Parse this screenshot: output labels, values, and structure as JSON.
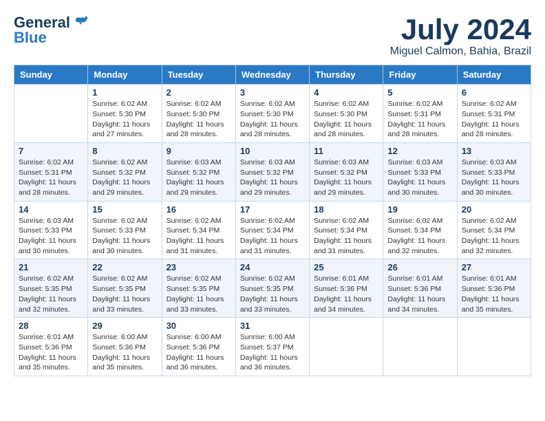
{
  "logo": {
    "line1": "General",
    "line2": "Blue"
  },
  "title": "July 2024",
  "location": "Miguel Calmon, Bahia, Brazil",
  "days_of_week": [
    "Sunday",
    "Monday",
    "Tuesday",
    "Wednesday",
    "Thursday",
    "Friday",
    "Saturday"
  ],
  "weeks": [
    [
      {
        "day": "",
        "info": ""
      },
      {
        "day": "1",
        "info": "Sunrise: 6:02 AM\nSunset: 5:30 PM\nDaylight: 11 hours\nand 27 minutes."
      },
      {
        "day": "2",
        "info": "Sunrise: 6:02 AM\nSunset: 5:30 PM\nDaylight: 11 hours\nand 28 minutes."
      },
      {
        "day": "3",
        "info": "Sunrise: 6:02 AM\nSunset: 5:30 PM\nDaylight: 11 hours\nand 28 minutes."
      },
      {
        "day": "4",
        "info": "Sunrise: 6:02 AM\nSunset: 5:30 PM\nDaylight: 11 hours\nand 28 minutes."
      },
      {
        "day": "5",
        "info": "Sunrise: 6:02 AM\nSunset: 5:31 PM\nDaylight: 11 hours\nand 28 minutes."
      },
      {
        "day": "6",
        "info": "Sunrise: 6:02 AM\nSunset: 5:31 PM\nDaylight: 11 hours\nand 28 minutes."
      }
    ],
    [
      {
        "day": "7",
        "info": "Sunrise: 6:02 AM\nSunset: 5:31 PM\nDaylight: 11 hours\nand 28 minutes."
      },
      {
        "day": "8",
        "info": "Sunrise: 6:02 AM\nSunset: 5:32 PM\nDaylight: 11 hours\nand 29 minutes."
      },
      {
        "day": "9",
        "info": "Sunrise: 6:03 AM\nSunset: 5:32 PM\nDaylight: 11 hours\nand 29 minutes."
      },
      {
        "day": "10",
        "info": "Sunrise: 6:03 AM\nSunset: 5:32 PM\nDaylight: 11 hours\nand 29 minutes."
      },
      {
        "day": "11",
        "info": "Sunrise: 6:03 AM\nSunset: 5:32 PM\nDaylight: 11 hours\nand 29 minutes."
      },
      {
        "day": "12",
        "info": "Sunrise: 6:03 AM\nSunset: 5:33 PM\nDaylight: 11 hours\nand 30 minutes."
      },
      {
        "day": "13",
        "info": "Sunrise: 6:03 AM\nSunset: 5:33 PM\nDaylight: 11 hours\nand 30 minutes."
      }
    ],
    [
      {
        "day": "14",
        "info": "Sunrise: 6:03 AM\nSunset: 5:33 PM\nDaylight: 11 hours\nand 30 minutes."
      },
      {
        "day": "15",
        "info": "Sunrise: 6:02 AM\nSunset: 5:33 PM\nDaylight: 11 hours\nand 30 minutes."
      },
      {
        "day": "16",
        "info": "Sunrise: 6:02 AM\nSunset: 5:34 PM\nDaylight: 11 hours\nand 31 minutes."
      },
      {
        "day": "17",
        "info": "Sunrise: 6:02 AM\nSunset: 5:34 PM\nDaylight: 11 hours\nand 31 minutes."
      },
      {
        "day": "18",
        "info": "Sunrise: 6:02 AM\nSunset: 5:34 PM\nDaylight: 11 hours\nand 31 minutes."
      },
      {
        "day": "19",
        "info": "Sunrise: 6:02 AM\nSunset: 5:34 PM\nDaylight: 11 hours\nand 32 minutes."
      },
      {
        "day": "20",
        "info": "Sunrise: 6:02 AM\nSunset: 5:34 PM\nDaylight: 11 hours\nand 32 minutes."
      }
    ],
    [
      {
        "day": "21",
        "info": "Sunrise: 6:02 AM\nSunset: 5:35 PM\nDaylight: 11 hours\nand 32 minutes."
      },
      {
        "day": "22",
        "info": "Sunrise: 6:02 AM\nSunset: 5:35 PM\nDaylight: 11 hours\nand 33 minutes."
      },
      {
        "day": "23",
        "info": "Sunrise: 6:02 AM\nSunset: 5:35 PM\nDaylight: 11 hours\nand 33 minutes."
      },
      {
        "day": "24",
        "info": "Sunrise: 6:02 AM\nSunset: 5:35 PM\nDaylight: 11 hours\nand 33 minutes."
      },
      {
        "day": "25",
        "info": "Sunrise: 6:01 AM\nSunset: 5:36 PM\nDaylight: 11 hours\nand 34 minutes."
      },
      {
        "day": "26",
        "info": "Sunrise: 6:01 AM\nSunset: 5:36 PM\nDaylight: 11 hours\nand 34 minutes."
      },
      {
        "day": "27",
        "info": "Sunrise: 6:01 AM\nSunset: 5:36 PM\nDaylight: 11 hours\nand 35 minutes."
      }
    ],
    [
      {
        "day": "28",
        "info": "Sunrise: 6:01 AM\nSunset: 5:36 PM\nDaylight: 11 hours\nand 35 minutes."
      },
      {
        "day": "29",
        "info": "Sunrise: 6:00 AM\nSunset: 5:36 PM\nDaylight: 11 hours\nand 35 minutes."
      },
      {
        "day": "30",
        "info": "Sunrise: 6:00 AM\nSunset: 5:36 PM\nDaylight: 11 hours\nand 36 minutes."
      },
      {
        "day": "31",
        "info": "Sunrise: 6:00 AM\nSunset: 5:37 PM\nDaylight: 11 hours\nand 36 minutes."
      },
      {
        "day": "",
        "info": ""
      },
      {
        "day": "",
        "info": ""
      },
      {
        "day": "",
        "info": ""
      }
    ]
  ]
}
